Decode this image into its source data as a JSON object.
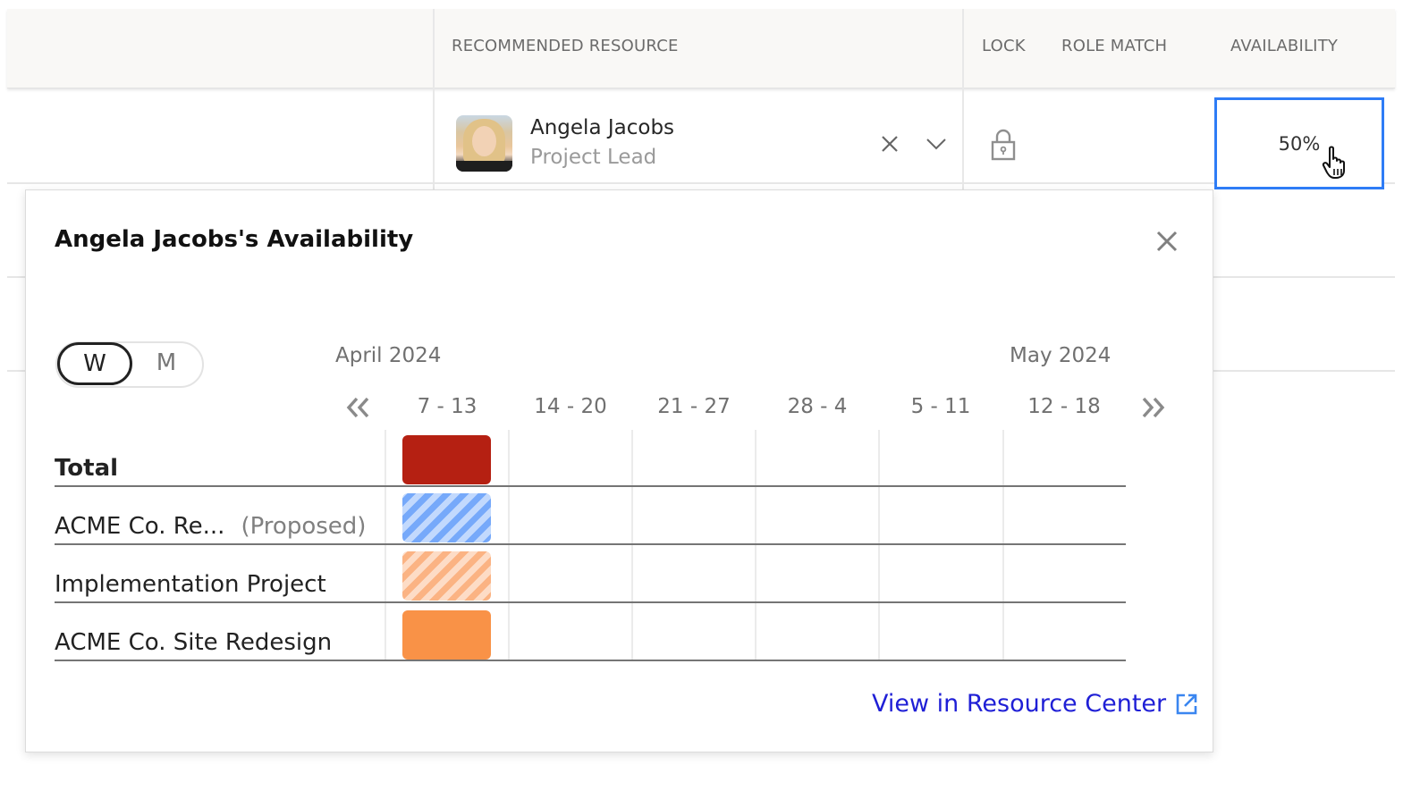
{
  "table": {
    "columns": {
      "recommended_resource": "RECOMMENDED RESOURCE",
      "lock": "LOCK",
      "role_match": "ROLE MATCH",
      "availability": "AVAILABILITY"
    },
    "row": {
      "resource_name": "Angela Jacobs",
      "resource_role": "Project Lead",
      "avatar_icon": "person-photo",
      "clear_icon": "close-icon",
      "dropdown_icon": "chevron-down-icon",
      "lock_icon": "padlock-icon",
      "availability": "50%"
    }
  },
  "popover": {
    "title": "Angela Jacobs's Availability",
    "close_icon": "close-icon",
    "view_toggle": {
      "options": [
        "W",
        "M"
      ],
      "selected": "W"
    },
    "months": [
      "April 2024",
      "May 2024"
    ],
    "prev_icon": "double-chevron-left-icon",
    "next_icon": "double-chevron-right-icon",
    "weeks": [
      "7 - 13",
      "14 - 20",
      "21 - 27",
      "28 - 4",
      "5 - 11",
      "12 - 18"
    ],
    "rows": [
      {
        "label": "Total",
        "suffix": "",
        "style": "total",
        "weeks_filled": [
          "7 - 13"
        ]
      },
      {
        "label": "ACME Co. Re...",
        "suffix": "(Proposed)",
        "style": "proposed",
        "weeks_filled": [
          "7 - 13"
        ]
      },
      {
        "label": "Implementation Project",
        "suffix": "",
        "style": "tentative",
        "weeks_filled": [
          "7 - 13"
        ]
      },
      {
        "label": "ACME Co. Site Redesign",
        "suffix": "",
        "style": "confirmed",
        "weeks_filled": [
          "7 - 13"
        ]
      }
    ],
    "colors": {
      "total": "#b52012",
      "proposed": "#76a9fa",
      "tentative": "#fbb383",
      "confirmed": "#f99247",
      "selection_border": "#2e7cf6",
      "link": "#1f1fd6"
    },
    "link_label": "View in Resource Center",
    "link_icon": "external-link-icon"
  }
}
